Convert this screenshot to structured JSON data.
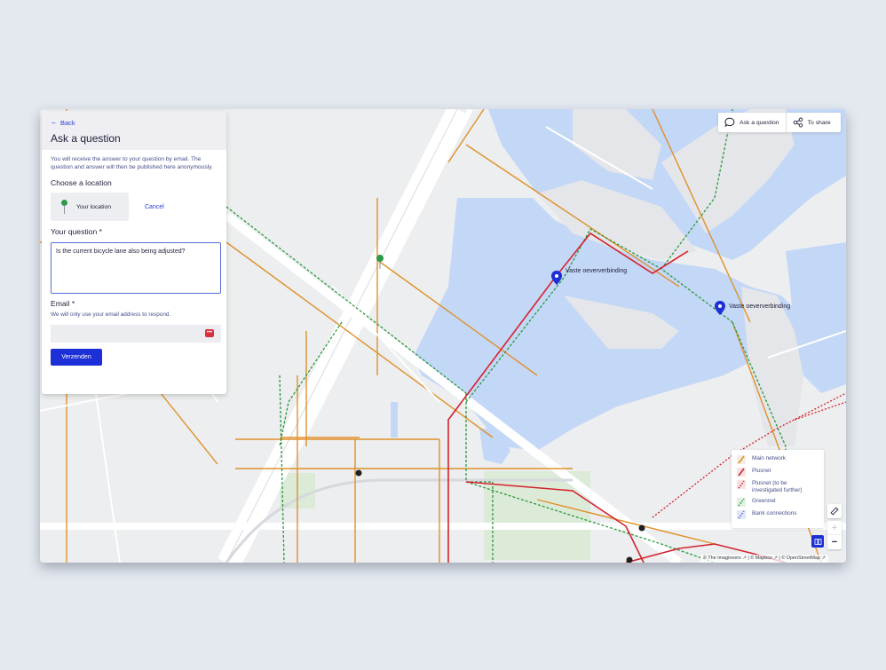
{
  "panel": {
    "back_label": "Back",
    "title": "Ask a question",
    "intro": "You will receive the answer to your question by email. The question and answer will then be published here anonymously.",
    "location_heading": "Choose a location",
    "location_option": "Your location",
    "cancel_label": "Cancel",
    "question_label": "Your question *",
    "question_value": "Is the current bicycle lane also being adjusted?",
    "email_label": "Email *",
    "email_hint": "We will only use your email address to respond.",
    "email_value": "",
    "submit_label": "Verzenden"
  },
  "toolbar": {
    "ask_label": "Ask a question",
    "share_label": "To share"
  },
  "legend": {
    "items": [
      {
        "label": "Main network",
        "color": "#e0912c",
        "style": "solid"
      },
      {
        "label": "Plusnet",
        "color": "#d4232e",
        "style": "solid"
      },
      {
        "label": "Plusnet (to be investigated further)",
        "color": "#d4232e",
        "style": "dotted"
      },
      {
        "label": "Greennet",
        "color": "#2a9a3c",
        "style": "dotted"
      },
      {
        "label": "Bank connections",
        "color": "#5a6ad8",
        "style": "dotted"
      }
    ]
  },
  "map": {
    "pins": [
      {
        "label": "Vaste oeververbinding"
      },
      {
        "label": "Vaste oeververbinding"
      }
    ],
    "attribution": [
      "© The Imagineers",
      "© Mapbox",
      "© OpenStreetMap"
    ]
  },
  "colors": {
    "accent": "#1d2fd6",
    "water": "#c3d7f7",
    "main_network": "#e0912c",
    "plusnet": "#d4232e",
    "greennet": "#2a9a3c"
  }
}
